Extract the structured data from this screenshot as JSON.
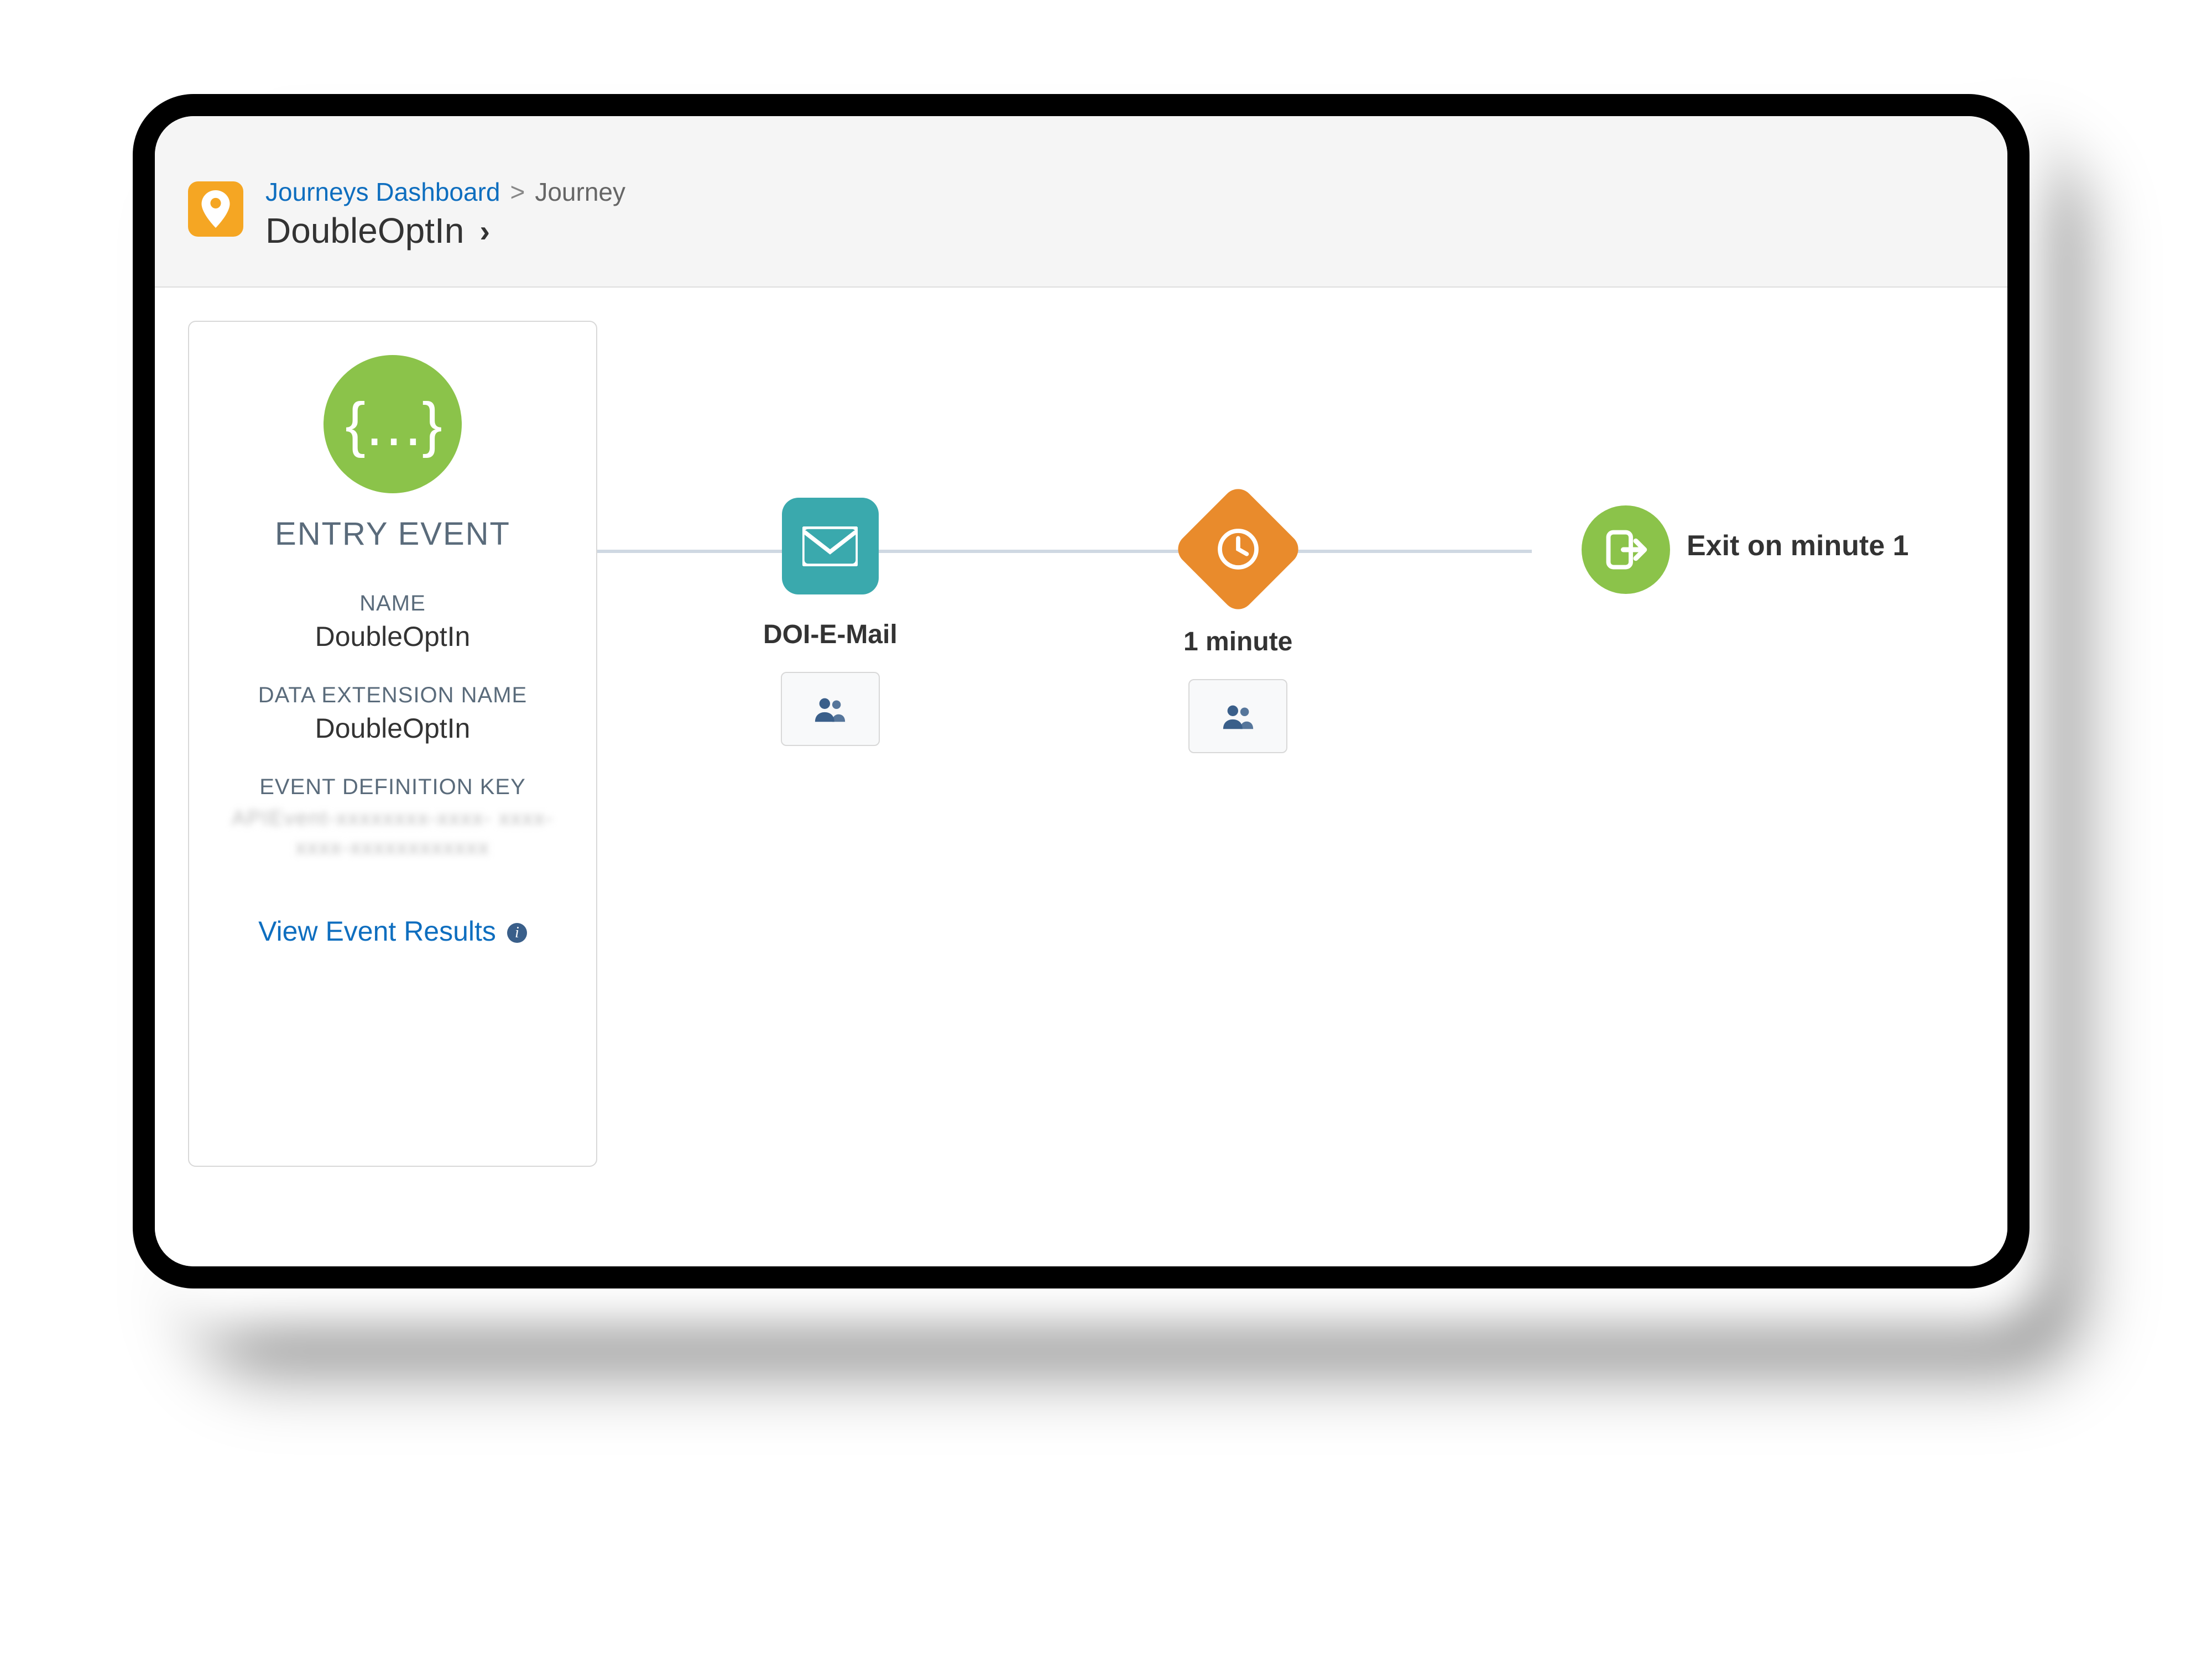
{
  "breadcrumb": {
    "root_link": "Journeys Dashboard",
    "sep": ">",
    "current_parent": "Journey"
  },
  "page_title": "DoubleOptIn",
  "entry_event": {
    "title": "ENTRY EVENT",
    "name_label": "NAME",
    "name_value": "DoubleOptIn",
    "de_label": "DATA EXTENSION NAME",
    "de_value": "DoubleOptIn",
    "key_label": "EVENT DEFINITION KEY",
    "key_value_redacted": "APIEvent-xxxxxxxx-xxxx-\nxxxx-xxxx-xxxxxxxxxxxx",
    "view_results": "View Event Results"
  },
  "nodes": {
    "email_label": "DOI-E-Mail",
    "wait_label": "1 minute",
    "exit_label": "Exit on minute 1"
  }
}
